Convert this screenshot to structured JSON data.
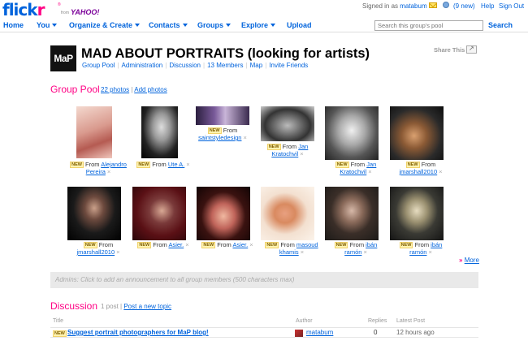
{
  "brand": {
    "logo_a": "flick",
    "logo_b": "r",
    "reg": "®",
    "from": "from",
    "yahoo": "YAHOO!"
  },
  "account": {
    "signed_in_as": "Signed in as",
    "username": "matabum",
    "mail_count": "(9 new)",
    "help": "Help",
    "sign_out": "Sign Out"
  },
  "nav": {
    "items": [
      {
        "label": "Home",
        "menu": false
      },
      {
        "label": "You",
        "menu": true
      },
      {
        "label": "Organize & Create",
        "menu": true
      },
      {
        "label": "Contacts",
        "menu": true
      },
      {
        "label": "Groups",
        "menu": true
      },
      {
        "label": "Explore",
        "menu": true
      },
      {
        "label": "Upload",
        "menu": false
      }
    ],
    "search_placeholder": "Search this group's pool",
    "search_button": "Search"
  },
  "group": {
    "buddy_icon_text": "MaP",
    "title": "MAD ABOUT PORTRAITS (looking for artists)",
    "links": [
      "Group Pool",
      "Administration",
      "Discussion",
      "13 Members",
      "Map",
      "Invite Friends"
    ],
    "share": "Share This"
  },
  "pool": {
    "title": "Group Pool",
    "count_link": "22 photos",
    "sep": "|",
    "add_link": "Add photos",
    "badge": "NEW",
    "from": "From",
    "remove": "×",
    "photos": [
      {
        "author": "Alejandro Pereira"
      },
      {
        "author": "Ute A."
      },
      {
        "author": "saintstyledesign"
      },
      {
        "author": "Jan Kratochvil"
      },
      {
        "author": "Jan Kratochvil"
      },
      {
        "author": "jmarshall2010"
      },
      {
        "author": "jmarshall2010"
      },
      {
        "author": "Asier."
      },
      {
        "author": "Asier."
      },
      {
        "author": "masoud khamis"
      },
      {
        "author": "ibán ramón"
      },
      {
        "author": "ibán ramón"
      }
    ],
    "more_marker": "»",
    "more": "More"
  },
  "announcement": "Admins: Click to add an announcement to all group members (500 characters max)",
  "discussion": {
    "title": "Discussion",
    "count": "1 post",
    "sep": "|",
    "new_topic": "Post a new topic",
    "headers": {
      "title": "Title",
      "author": "Author",
      "replies": "Replies",
      "latest": "Latest Post"
    },
    "rows": [
      {
        "badge": "NEW",
        "title": "Suggest portrait photographers for MaP blog!",
        "author": "matabum",
        "replies": "0",
        "latest": "12 hours ago"
      }
    ]
  }
}
